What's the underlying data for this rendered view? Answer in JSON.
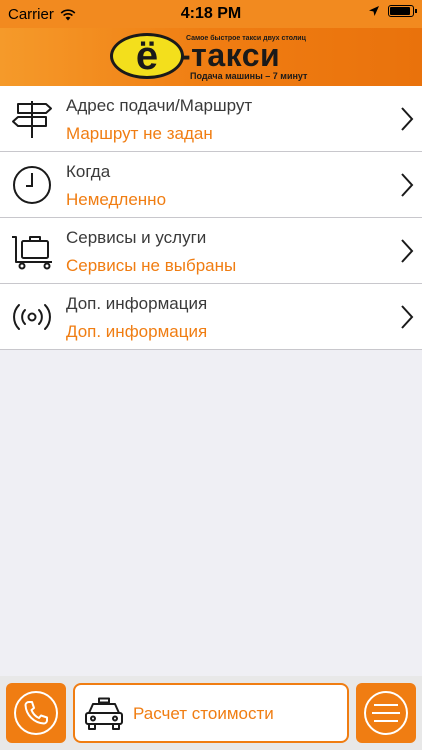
{
  "status_bar": {
    "carrier": "Carrier",
    "time": "4:18 PM",
    "battery_level": 0.9
  },
  "header": {
    "logo_letter": "ё",
    "logo_name": "-такси",
    "logo_tagline": "Самое быстрое такси двух столиц",
    "logo_subtitle": "Подача машины – 7 минут"
  },
  "rows": [
    {
      "title": "Адрес подачи/Маршрут",
      "value": "Маршрут не задан",
      "icon": "signpost-icon"
    },
    {
      "title": "Когда",
      "value": "Немедленно",
      "icon": "clock-icon"
    },
    {
      "title": "Сервисы и услуги",
      "value": "Сервисы не выбраны",
      "icon": "luggage-cart-icon"
    },
    {
      "title": "Доп. информация",
      "value": "Доп. информация",
      "icon": "broadcast-icon"
    }
  ],
  "bottom_bar": {
    "calc_label": "Расчет стоимости"
  },
  "colors": {
    "accent": "#f07d12",
    "status_bar": "#f28a1f",
    "background": "#efeff4",
    "logo_yellow": "#f3df1c"
  }
}
